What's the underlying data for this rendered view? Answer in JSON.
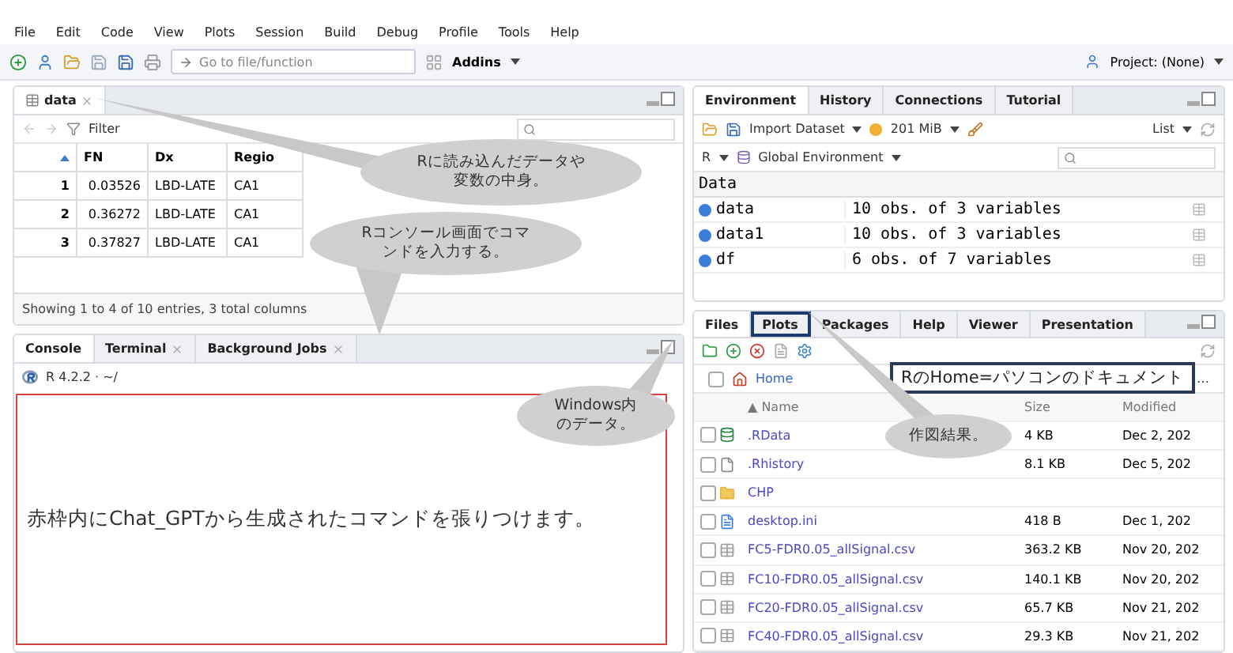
{
  "menu": [
    "File",
    "Edit",
    "Code",
    "View",
    "Plots",
    "Session",
    "Build",
    "Debug",
    "Profile",
    "Tools",
    "Help"
  ],
  "toolbar": {
    "goto_placeholder": "Go to file/function",
    "addins": "Addins",
    "project": "Project: (None)"
  },
  "data_viewer": {
    "tab": "data",
    "filter": "Filter",
    "columns": [
      "FN",
      "Dx",
      "Regio"
    ],
    "rows": [
      {
        "index": "1",
        "cells": [
          "0.03526",
          "LBD-LATE",
          "CA1"
        ]
      },
      {
        "index": "2",
        "cells": [
          "0.36272",
          "LBD-LATE",
          "CA1"
        ]
      },
      {
        "index": "3",
        "cells": [
          "0.37827",
          "LBD-LATE",
          "CA1"
        ]
      }
    ],
    "status": "Showing 1 to 4 of 10 entries, 3 total columns"
  },
  "console": {
    "tabs": [
      {
        "label": "Console",
        "selected": true,
        "closable": false
      },
      {
        "label": "Terminal",
        "selected": false,
        "closable": true
      },
      {
        "label": "Background Jobs",
        "selected": false,
        "closable": true
      }
    ],
    "version": "R 4.2.2 · ~/",
    "note": "赤枠内にChat_GPTから生成されたコマンドを張りつけます。"
  },
  "environment": {
    "tabs": [
      {
        "label": "Environment",
        "selected": true
      },
      {
        "label": "History",
        "selected": false
      },
      {
        "label": "Connections",
        "selected": false
      },
      {
        "label": "Tutorial",
        "selected": false
      }
    ],
    "import": "Import Dataset",
    "memory": "201 MiB",
    "view": "List",
    "language": "R",
    "scope": "Global Environment",
    "section": "Data",
    "rows": [
      {
        "name": "data",
        "value": "10 obs. of 3 variables"
      },
      {
        "name": "data1",
        "value": "10 obs. of 3 variables"
      },
      {
        "name": "df",
        "value": "6 obs. of 7 variables"
      }
    ]
  },
  "files": {
    "tabs": [
      {
        "label": "Files",
        "selected": true,
        "highlighted": false
      },
      {
        "label": "Plots",
        "selected": false,
        "highlighted": true
      },
      {
        "label": "Packages",
        "selected": false,
        "highlighted": false
      },
      {
        "label": "Help",
        "selected": false,
        "highlighted": false
      },
      {
        "label": "Viewer",
        "selected": false,
        "highlighted": false
      },
      {
        "label": "Presentation",
        "selected": false,
        "highlighted": false
      }
    ],
    "all_checked": false,
    "path": "Home",
    "path_note": "RのHome=パソコンのドキュメント",
    "path_more": "…",
    "columns": [
      "▲ Name",
      "Size",
      "Modified"
    ],
    "rows": [
      {
        "kind": "rdata",
        "checked": false,
        "name": ".RData",
        "size": "4 KB",
        "modified": "Dec 2, 202"
      },
      {
        "kind": "history",
        "checked": false,
        "name": ".Rhistory",
        "size": "8.1 KB",
        "modified": "Dec 5, 202"
      },
      {
        "kind": "folder",
        "checked": false,
        "name": "CHP"
      },
      {
        "kind": "ini",
        "checked": false,
        "name": "desktop.ini",
        "size": "418 B",
        "modified": "Dec 1, 202"
      },
      {
        "kind": "csv",
        "checked": false,
        "name": "FC5-FDR0.05_allSignal.csv",
        "size": "363.2 KB",
        "modified": "Nov 20, 202"
      },
      {
        "kind": "csv",
        "checked": false,
        "name": "FC10-FDR0.05_allSignal.csv",
        "size": "140.1 KB",
        "modified": "Nov 20, 202"
      },
      {
        "kind": "csv",
        "checked": false,
        "name": "FC20-FDR0.05_allSignal.csv",
        "size": "65.7 KB",
        "modified": "Nov 21, 202"
      },
      {
        "kind": "csv",
        "checked": false,
        "name": "FC40-FDR0.05_allSignal.csv",
        "size": "29.3 KB",
        "modified": "Nov 21, 202"
      }
    ]
  },
  "callouts": [
    "Rに読み込んだデータや変数の中身。",
    "Rコンソール画面でコマンドを入力する。",
    "Windows内のデータ。",
    "作図結果。"
  ]
}
